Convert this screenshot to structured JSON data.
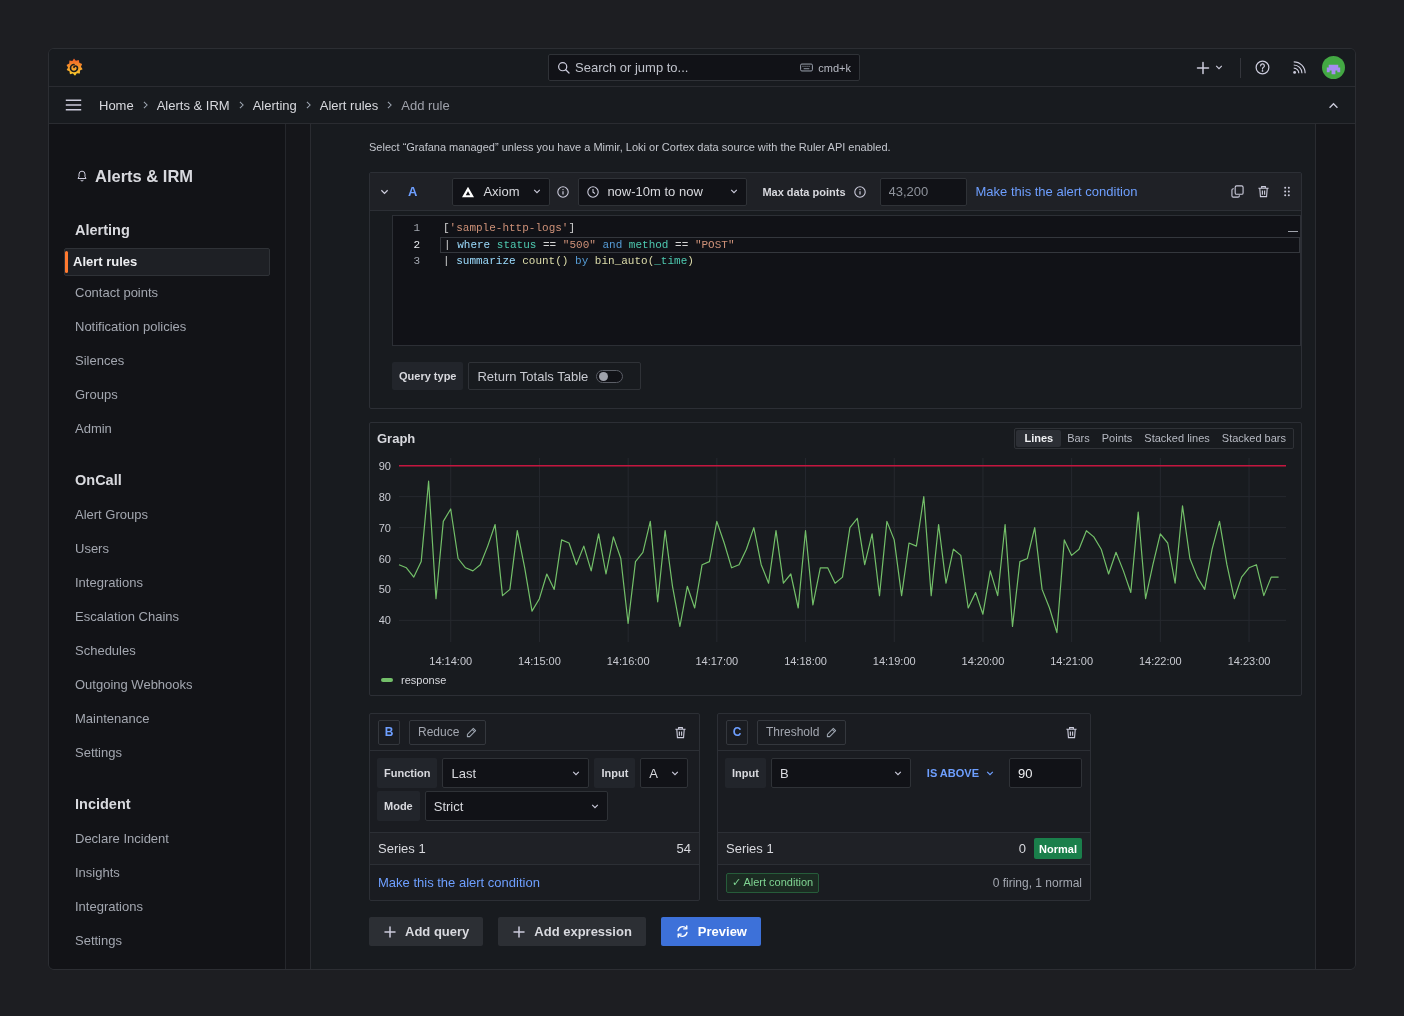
{
  "topbar": {
    "search": {
      "placeholder": "Search or jump to...",
      "shortcut": "cmd+k"
    }
  },
  "breadcrumbs": [
    {
      "label": "Home",
      "current": false
    },
    {
      "label": "Alerts & IRM",
      "current": false
    },
    {
      "label": "Alerting",
      "current": false
    },
    {
      "label": "Alert rules",
      "current": false
    },
    {
      "label": "Add rule",
      "current": true
    }
  ],
  "sidebar": {
    "title": "Alerts & IRM",
    "sections": [
      {
        "title": "Alerting",
        "items": [
          {
            "label": "Alert rules",
            "selected": true
          },
          {
            "label": "Contact points",
            "selected": false
          },
          {
            "label": "Notification policies",
            "selected": false
          },
          {
            "label": "Silences",
            "selected": false
          },
          {
            "label": "Groups",
            "selected": false
          },
          {
            "label": "Admin",
            "selected": false
          }
        ]
      },
      {
        "title": "OnCall",
        "items": [
          {
            "label": "Alert Groups",
            "selected": false
          },
          {
            "label": "Users",
            "selected": false
          },
          {
            "label": "Integrations",
            "selected": false
          },
          {
            "label": "Escalation Chains",
            "selected": false
          },
          {
            "label": "Schedules",
            "selected": false
          },
          {
            "label": "Outgoing Webhooks",
            "selected": false
          },
          {
            "label": "Maintenance",
            "selected": false
          },
          {
            "label": "Settings",
            "selected": false
          }
        ]
      },
      {
        "title": "Incident",
        "items": [
          {
            "label": "Declare Incident",
            "selected": false
          },
          {
            "label": "Insights",
            "selected": false
          },
          {
            "label": "Integrations",
            "selected": false
          },
          {
            "label": "Settings",
            "selected": false
          }
        ]
      }
    ]
  },
  "form": {
    "hint": "Select “Grafana managed” unless you have a Mimir, Loki or Cortex data source with the Ruler API enabled.",
    "query": {
      "ref_id": "A",
      "expanded": true,
      "datasource": "Axiom",
      "time_range": "now-10m to now",
      "max_data_points": {
        "label": "Max data points",
        "placeholder": "43,200"
      },
      "alert_condition": false,
      "condition_label": "Make this the alert condition",
      "code": [
        {
          "number": "1",
          "current": false,
          "tokens": [
            {
              "text": "[",
              "kind": "plain"
            },
            {
              "text": "'sample-http-logs'",
              "kind": "string"
            },
            {
              "text": "]",
              "kind": "plain"
            }
          ]
        },
        {
          "number": "2",
          "current": true,
          "tokens": [
            {
              "text": "| ",
              "kind": "plain"
            },
            {
              "text": "where ",
              "kind": "keyword"
            },
            {
              "text": "status",
              "kind": "field"
            },
            {
              "text": " == ",
              "kind": "plain"
            },
            {
              "text": "\"500\"",
              "kind": "string"
            },
            {
              "text": " and ",
              "kind": "operator"
            },
            {
              "text": "method",
              "kind": "field"
            },
            {
              "text": " == ",
              "kind": "plain"
            },
            {
              "text": "\"POST\"",
              "kind": "string"
            }
          ]
        },
        {
          "number": "3",
          "current": false,
          "tokens": [
            {
              "text": "| ",
              "kind": "plain"
            },
            {
              "text": "summarize ",
              "kind": "keyword"
            },
            {
              "text": "count()",
              "kind": "function"
            },
            {
              "text": " by ",
              "kind": "operator"
            },
            {
              "text": "bin_auto(",
              "kind": "function"
            },
            {
              "text": "_time",
              "kind": "field"
            },
            {
              "text": ")",
              "kind": "function"
            }
          ]
        }
      ],
      "query_type": {
        "label": "Query type",
        "value": "Return Totals Table",
        "on": false
      }
    },
    "graph": {
      "view_modes": [
        {
          "label": "Lines",
          "selected": true
        },
        {
          "label": "Bars",
          "selected": false
        },
        {
          "label": "Points",
          "selected": false
        },
        {
          "label": "Stacked lines",
          "selected": false
        },
        {
          "label": "Stacked bars",
          "selected": false
        }
      ],
      "chart_data": {
        "type": "line",
        "title": "Graph",
        "x": [
          51205,
          51210,
          51215,
          51220,
          51225,
          51230,
          51235,
          51240,
          51245,
          51250,
          51255,
          51260,
          51265,
          51270,
          51275,
          51280,
          51285,
          51290,
          51295,
          51300,
          51305,
          51310,
          51315,
          51320,
          51325,
          51330,
          51335,
          51340,
          51345,
          51350,
          51355,
          51360,
          51365,
          51370,
          51375,
          51380,
          51385,
          51390,
          51395,
          51400,
          51405,
          51410,
          51415,
          51420,
          51425,
          51430,
          51435,
          51440,
          51445,
          51450,
          51455,
          51460,
          51465,
          51470,
          51475,
          51480,
          51485,
          51490,
          51495,
          51500,
          51505,
          51510,
          51515,
          51520,
          51525,
          51530,
          51535,
          51540,
          51545,
          51550,
          51555,
          51560,
          51565,
          51570,
          51575,
          51580,
          51585,
          51590,
          51595,
          51600,
          51605,
          51610,
          51615,
          51620,
          51625,
          51630,
          51635,
          51640,
          51645,
          51650,
          51655,
          51660,
          51665,
          51670,
          51675,
          51680,
          51685,
          51690,
          51695,
          51700,
          51705,
          51710,
          51715,
          51720,
          51725,
          51730,
          51735,
          51740,
          51745,
          51750,
          51755,
          51760,
          51765,
          51770,
          51775,
          51780,
          51785,
          51790,
          51795,
          51800
        ],
        "series": [
          {
            "name": "response",
            "color": "#73bf69",
            "values": [
              58,
              57,
              54,
              59,
              85,
              47,
              72,
              76,
              60,
              57,
              56,
              58,
              64,
              71,
              48,
              50,
              69,
              57,
              43,
              47,
              55,
              50,
              66,
              65,
              58,
              64,
              56,
              68,
              55,
              67,
              60,
              39,
              59,
              62,
              72,
              46,
              69,
              51,
              38,
              51,
              44,
              58,
              59,
              72,
              65,
              57,
              58,
              63,
              70,
              58,
              52,
              69,
              52,
              55,
              44,
              69,
              45,
              57,
              57,
              52,
              54,
              70,
              73,
              58,
              68,
              48,
              72,
              66,
              48,
              65,
              64,
              80,
              48,
              71,
              52,
              63,
              61,
              44,
              49,
              42,
              56,
              48,
              71,
              38,
              59,
              60,
              70,
              50,
              44,
              36,
              66,
              61,
              63,
              69,
              67,
              63,
              55,
              62,
              56,
              49,
              75,
              47,
              58,
              68,
              65,
              52,
              77,
              60,
              54,
              50,
              63,
              72,
              58,
              47,
              54,
              57,
              58,
              48,
              54,
              54
            ]
          }
        ],
        "xlim": [
          51205,
          51805
        ],
        "ylim": [
          33,
          92.5
        ],
        "xticks": [
          {
            "value": 51240,
            "label": "14:14:00"
          },
          {
            "value": 51300,
            "label": "14:15:00"
          },
          {
            "value": 51360,
            "label": "14:16:00"
          },
          {
            "value": 51420,
            "label": "14:17:00"
          },
          {
            "value": 51480,
            "label": "14:18:00"
          },
          {
            "value": 51540,
            "label": "14:19:00"
          },
          {
            "value": 51600,
            "label": "14:20:00"
          },
          {
            "value": 51660,
            "label": "14:21:00"
          },
          {
            "value": 51720,
            "label": "14:22:00"
          },
          {
            "value": 51780,
            "label": "14:23:00"
          }
        ],
        "yticks": [
          40,
          50,
          60,
          70,
          80,
          90
        ],
        "grid": true,
        "ref_lines": [
          {
            "axis": "y",
            "value": 90,
            "color": "#c4163f"
          }
        ]
      }
    },
    "expressions": [
      {
        "kind": "reduce",
        "ref_id": "B",
        "name": "Reduce",
        "rows": [
          [
            {
              "label": "Function",
              "value": "Last"
            },
            {
              "label": "Input",
              "value": "A"
            }
          ],
          [
            {
              "label": "Mode",
              "value": "Strict"
            }
          ]
        ],
        "result": {
          "series": "Series 1",
          "value": "54"
        },
        "alert_condition": false,
        "condition_label": "Make this the alert condition"
      },
      {
        "kind": "threshold",
        "ref_id": "C",
        "name": "Threshold",
        "input": {
          "label": "Input",
          "value": "B"
        },
        "operator": "IS ABOVE",
        "threshold": "90",
        "result": {
          "series": "Series 1",
          "value": "0",
          "state": "Normal"
        },
        "alert_condition": true,
        "condition_label": "✓ Alert condition",
        "summary": "0 firing, 1 normal"
      }
    ],
    "buttons": [
      {
        "label": "Add query",
        "kind": "add"
      },
      {
        "label": "Add expression",
        "kind": "add"
      },
      {
        "label": "Preview",
        "kind": "primary"
      }
    ]
  }
}
